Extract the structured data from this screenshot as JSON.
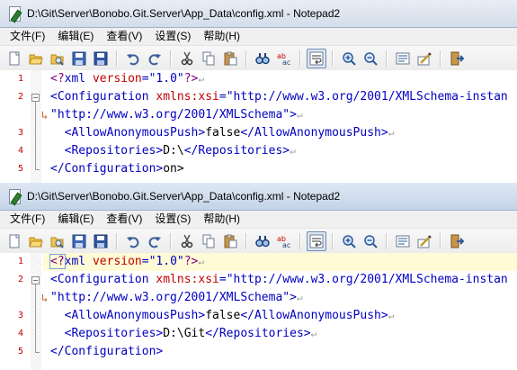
{
  "windows": [
    {
      "title": "D:\\Git\\Server\\Bonobo.Git.Server\\App_Data\\config.xml - Notepad2",
      "lines": [
        {
          "num": "1",
          "parts": [
            {
              "c": "t-pi",
              "t": "<?"
            },
            {
              "c": "t-tag",
              "t": "xml "
            },
            {
              "c": "t-attr",
              "t": "version"
            },
            {
              "c": "t-tag",
              "t": "="
            },
            {
              "c": "t-val",
              "t": "\"1.0\""
            },
            {
              "c": "t-pi",
              "t": "?>"
            }
          ],
          "eol": "↵"
        },
        {
          "num": "2",
          "parts": [
            {
              "c": "t-tag",
              "t": "<Configuration "
            },
            {
              "c": "t-attr",
              "t": "xmlns:xsi"
            },
            {
              "c": "t-tag",
              "t": "="
            },
            {
              "c": "t-val",
              "t": "\"http://www.w3.org/2001/XMLSchema-instan"
            }
          ],
          "eol": ""
        },
        {
          "num": "",
          "wrap": "↳",
          "parts": [
            {
              "c": "t-val",
              "t": "\"http://www.w3.org/2001/XMLSchema\""
            },
            {
              "c": "t-tag",
              "t": ">"
            }
          ],
          "eol": "↵"
        },
        {
          "num": "3",
          "parts": [
            {
              "c": "t-tag",
              "t": "  <AllowAnonymousPush>"
            },
            {
              "c": "t-text",
              "t": "false"
            },
            {
              "c": "t-tag",
              "t": "</AllowAnonymousPush>"
            }
          ],
          "eol": "↵"
        },
        {
          "num": "4",
          "parts": [
            {
              "c": "t-tag",
              "t": "  <Repositories>"
            },
            {
              "c": "t-text",
              "t": "D:\\"
            },
            {
              "c": "t-tag",
              "t": "</Repositories>"
            }
          ],
          "eol": "↵"
        },
        {
          "num": "5",
          "parts": [
            {
              "c": "t-tag",
              "t": "</Configuration>"
            },
            {
              "c": "t-text",
              "t": "on>"
            }
          ],
          "eol": ""
        }
      ]
    },
    {
      "title": "D:\\Git\\Server\\Bonobo.Git.Server\\App_Data\\config.xml - Notepad2",
      "lines": [
        {
          "num": "1",
          "current": true,
          "parts": [
            {
              "c": "t-pi caret-box",
              "t": "<?"
            },
            {
              "c": "t-tag",
              "t": "xml "
            },
            {
              "c": "t-attr",
              "t": "version"
            },
            {
              "c": "t-tag",
              "t": "="
            },
            {
              "c": "t-val",
              "t": "\"1.0\""
            },
            {
              "c": "t-pi",
              "t": "?>"
            }
          ],
          "eol": "↵"
        },
        {
          "num": "2",
          "parts": [
            {
              "c": "t-tag",
              "t": "<Configuration "
            },
            {
              "c": "t-attr",
              "t": "xmlns:xsi"
            },
            {
              "c": "t-tag",
              "t": "="
            },
            {
              "c": "t-val",
              "t": "\"http://www.w3.org/2001/XMLSchema-instan"
            }
          ],
          "eol": ""
        },
        {
          "num": "",
          "wrap": "↳",
          "parts": [
            {
              "c": "t-val",
              "t": "\"http://www.w3.org/2001/XMLSchema\""
            },
            {
              "c": "t-tag",
              "t": ">"
            }
          ],
          "eol": "↵"
        },
        {
          "num": "3",
          "parts": [
            {
              "c": "t-tag",
              "t": "  <AllowAnonymousPush>"
            },
            {
              "c": "t-text",
              "t": "false"
            },
            {
              "c": "t-tag",
              "t": "</AllowAnonymousPush>"
            }
          ],
          "eol": "↵"
        },
        {
          "num": "4",
          "parts": [
            {
              "c": "t-tag",
              "t": "  <Repositories>"
            },
            {
              "c": "t-text",
              "t": "D:\\Git"
            },
            {
              "c": "t-tag",
              "t": "</Repositories>"
            }
          ],
          "eol": "↵"
        },
        {
          "num": "5",
          "parts": [
            {
              "c": "t-tag",
              "t": "</Configuration>"
            }
          ],
          "eol": ""
        }
      ]
    }
  ],
  "menu": {
    "file": "文件(F)",
    "edit": "编辑(E)",
    "view": "查看(V)",
    "settings": "设置(S)",
    "help": "帮助(H)"
  },
  "toolbar_icons": [
    "new-icon",
    "open-icon",
    "browse-icon",
    "save-icon",
    "save-as-icon",
    "|",
    "undo-icon",
    "redo-icon",
    "|",
    "cut-icon",
    "copy-icon",
    "paste-icon",
    "|",
    "find-icon",
    "replace-icon",
    "|",
    "word-wrap-icon",
    "|",
    "zoom-in-icon",
    "zoom-out-icon",
    "|",
    "schemes-icon",
    "customize-schemes-icon",
    "|",
    "exit-icon"
  ],
  "colors": {
    "tag": "#0000c0",
    "attribute": "#c00000",
    "line_number": "#c00000",
    "current_line": "#fffbd6"
  }
}
